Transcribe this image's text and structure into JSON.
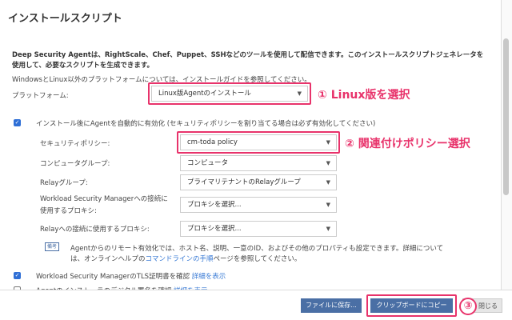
{
  "dialog": {
    "title": "インストールスクリプト"
  },
  "intro": {
    "line1": "Deep Security Agentは、RightScale、Chef、Puppet、SSHなどのツールを使用して配信できます。このインストールスクリプトジェネレータを",
    "line2": "使用して、必要なスクリプトを生成できます。",
    "platform_note": "WindowsとLinux以外のプラットフォームについては、インストールガイドを参照してください。"
  },
  "platform": {
    "label": "プラットフォーム:",
    "value": "Linux版Agentのインストール"
  },
  "annotations": {
    "a1": "① Linux版を選択",
    "a2": "② 関連付けポリシー選択",
    "a3": "③"
  },
  "activate": {
    "label": "インストール後にAgentを自動的に有効化 (セキュリティポリシーを割り当てる場合は必ず有効化してください)",
    "checked": true
  },
  "fields": [
    {
      "label": "セキュリティポリシー:",
      "value": "cm-toda policy"
    },
    {
      "label": "コンピュータグループ:",
      "value": "コンピュータ"
    },
    {
      "label": "Relayグループ:",
      "value": "プライマリテナントのRelayグループ"
    },
    {
      "label": "Workload Security Managerへの接続に",
      "label2": "使用するプロキシ:",
      "value": "プロキシを選択..."
    },
    {
      "label": "Relayへの接続に使用するプロキシ:",
      "value": "プロキシを選択..."
    }
  ],
  "note": {
    "badge": "備考",
    "line1": "Agentからのリモート有効化では、ホスト名、説明、一意のID、およびその他のプロパティも設定できます。詳細について",
    "line2_pre": "は、オンラインヘルプの",
    "line2_link": "コマンドラインの手順",
    "line2_post": "ページを参照してください。"
  },
  "tls": {
    "label": "Workload Security ManagerのTLS証明書を確認",
    "link": "詳細を表示",
    "checked": true
  },
  "sig": {
    "label": "Agentのインストーラのデジタル署名を確認",
    "link": "詳細を表示",
    "checked": false
  },
  "buttons": {
    "save": "ファイルに保存...",
    "copy": "クリップボードにコピー",
    "close": "閉じる"
  }
}
